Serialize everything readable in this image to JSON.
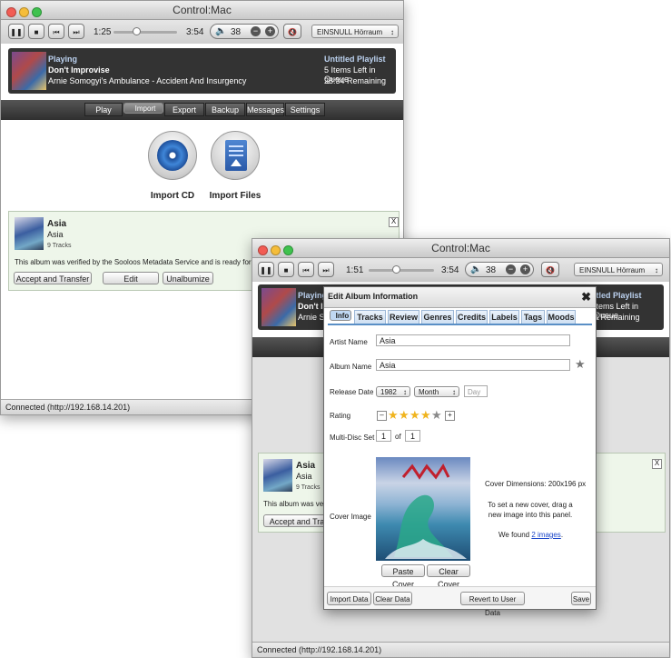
{
  "app": {
    "title": "Control:Mac",
    "transport": {
      "pause_icon": "pause-icon",
      "stop_icon": "stop-icon",
      "prev_icon": "previous-icon",
      "next_icon": "next-icon",
      "mute_icon": "mute-icon"
    },
    "zone": "EINSNULL Hörraum",
    "nav": [
      "Play",
      "Import",
      "Export",
      "Backup",
      "Messages",
      "Settings"
    ],
    "status": "Connected (http://192.168.14.201)",
    "now_playing": {
      "state": "Playing",
      "track": "Don't Improvise",
      "artist_album": "Arnie Somogyi's Ambulance - Accident And Insurgency",
      "playlist": "Untitled Playlist",
      "queue": "5 Items Left in Queue",
      "remaining": "28:34 Remaining"
    }
  },
  "win1": {
    "elapsed": "1:25",
    "total": "3:54",
    "volume": "38",
    "progress_fraction": 0.35,
    "import_cd": "Import CD",
    "import_files": "Import Files",
    "album": {
      "title": "Asia",
      "artist": "Asia",
      "tracks": "9 Tracks",
      "message": "This album was verified by the Sooloos Metadata Service and is ready for import.",
      "accept": "Accept and Transfer",
      "edit": "Edit",
      "unalbumize": "Unalbumize",
      "close": "X"
    }
  },
  "win2": {
    "elapsed": "1:51",
    "total": "3:54",
    "volume": "38",
    "progress_fraction": 0.42,
    "np_partial": {
      "state": "Playing",
      "track": "Don't I",
      "artist": "Arnie S",
      "playlist": "itled Playlist",
      "queue": "Items Left in Queue",
      "remaining": "4 Remaining"
    },
    "album": {
      "title": "Asia",
      "artist": "Asia",
      "tracks": "9 Tracks",
      "message": "This album was verifi",
      "accept": "Accept and Transf",
      "close": "X"
    }
  },
  "dialog": {
    "title": "Edit Album Information",
    "close": "✖",
    "tabs": [
      "Info",
      "Tracks",
      "Review",
      "Genres",
      "Credits",
      "Labels",
      "Tags",
      "Moods"
    ],
    "artist_label": "Artist Name",
    "artist_value": "Asia",
    "album_label": "Album Name",
    "album_value": "Asia",
    "release_label": "Release Date",
    "year": "1982",
    "month": "Month",
    "day_placeholder": "Day",
    "rating_label": "Rating",
    "rating_value": 4,
    "rating_max": 5,
    "rating_minus": "–",
    "rating_plus": "+",
    "multidisc_label": "Multi-Disc Set",
    "disc": "1",
    "of": "of",
    "disc_total": "1",
    "cover_label": "Cover Image",
    "cover_dims": "Cover Dimensions: 200x196 px",
    "cover_hint": "To set a new cover, drag a new image into this panel.",
    "found_prefix": "We found",
    "found_link": "2 images",
    "found_suffix": ".",
    "paste_cover": "Paste Cover",
    "clear_cover": "Clear Cover",
    "import_data": "Import Data",
    "clear_data": "Clear Data",
    "revert": "Revert to User Data",
    "save": "Save"
  }
}
